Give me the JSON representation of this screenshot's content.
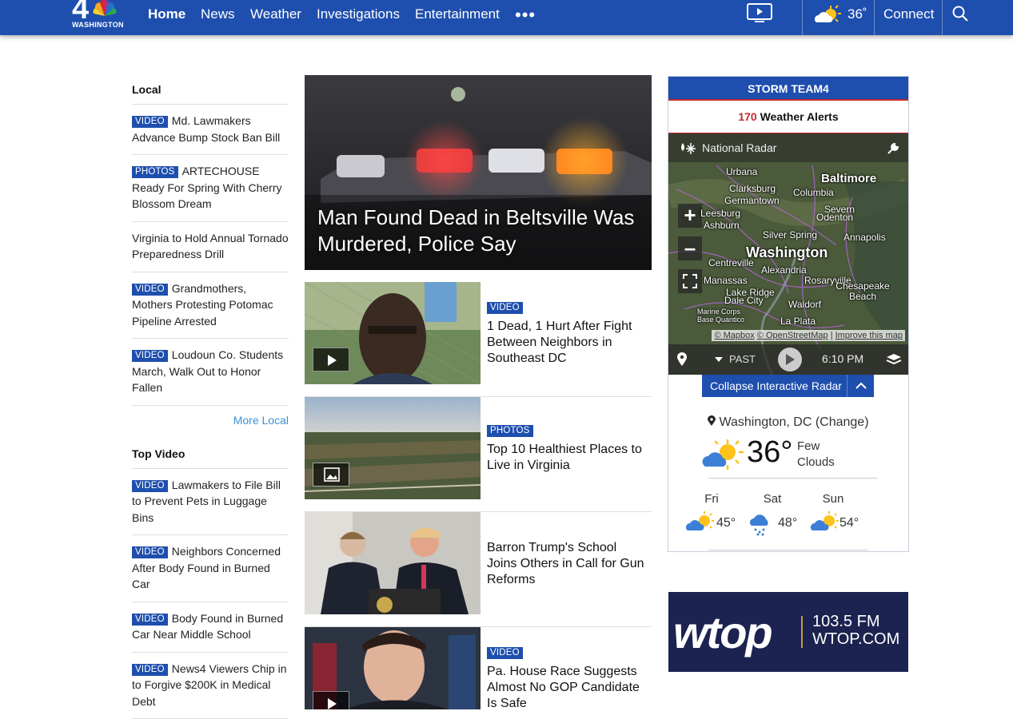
{
  "header": {
    "logo_number": "4",
    "logo_text": "WASHINGTON",
    "nav": [
      "Home",
      "News",
      "Weather",
      "Investigations",
      "Entertainment"
    ],
    "more": "•••",
    "temperature": "36˚",
    "connect": "Connect",
    "bg_color": "#1e4fae"
  },
  "left": {
    "local_title": "Local",
    "local_items": [
      {
        "badge": "VIDEO",
        "text": "Md. Lawmakers Advance Bump Stock Ban Bill"
      },
      {
        "badge": "PHOTOS",
        "text": "ARTECHOUSE Ready For Spring With Cherry Blossom Dream"
      },
      {
        "badge": "",
        "text": "Virginia to Hold Annual Tornado Preparedness Drill"
      },
      {
        "badge": "VIDEO",
        "text": "Grandmothers, Mothers Protesting Potomac Pipeline Arrested"
      },
      {
        "badge": "VIDEO",
        "text": "Loudoun Co. Students March, Walk Out to Honor Fallen"
      }
    ],
    "more_local": "More Local",
    "video_title": "Top Video",
    "video_items": [
      {
        "badge": "VIDEO",
        "text": "Lawmakers to File Bill to Prevent Pets in Luggage Bins"
      },
      {
        "badge": "VIDEO",
        "text": "Neighbors Concerned After Body Found in Burned Car"
      },
      {
        "badge": "VIDEO",
        "text": "Body Found in Burned Car Near Middle School"
      },
      {
        "badge": "VIDEO",
        "text": "News4 Viewers Chip in to Forgive $200K in Medical Debt"
      }
    ]
  },
  "center": {
    "hero_title": "Man Found Dead in Beltsville Was Murdered, Police Say",
    "stories": [
      {
        "badge": "VIDEO",
        "title": "1 Dead, 1 Hurt After Fight Between Neighbors in Southeast DC"
      },
      {
        "badge": "PHOTOS",
        "title": "Top 10 Healthiest Places to Live in Virginia"
      },
      {
        "badge": "",
        "title": "Barron Trump's School Joins Others in Call for Gun Reforms"
      },
      {
        "badge": "VIDEO",
        "title": "Pa. House Race Suggests Almost No GOP Candidate Is Safe"
      }
    ]
  },
  "weather": {
    "brand": "STORM TEAM4",
    "alerts_count": "170",
    "alerts_label": "Weather Alerts",
    "radar_title": "National Radar",
    "map_cities": [
      "Urbana",
      "Clarksburg",
      "Germantown",
      "Baltimore",
      "Columbia",
      "Severn",
      "Odenton",
      "Silver Spring",
      "Annapolis",
      "Washington",
      "Alexandria",
      "Centreville",
      "Manassas",
      "Rosaryville",
      "Lake Ridge",
      "Dale City",
      "Chesapeake Beach",
      "Waldorf",
      "Marine Corps Base Quantico",
      "La Plata",
      "Ashburn",
      "Leesburg"
    ],
    "map_attribution": [
      "© Mapbox",
      "© OpenStreetMap",
      "Improve this map"
    ],
    "past_label": "PAST",
    "time": "6:10 PM",
    "collapse_label": "Collapse Interactive Radar",
    "location": "Washington, DC (Change)",
    "current_temp": "36°",
    "current_desc": "Few Clouds",
    "forecast": [
      {
        "day": "Fri",
        "temp": "45°",
        "icon": "partly-sunny-icon"
      },
      {
        "day": "Sat",
        "temp": "48°",
        "icon": "rain-icon"
      },
      {
        "day": "Sun",
        "temp": "54°",
        "icon": "partly-sunny-icon"
      }
    ]
  },
  "ad": {
    "logo": "wtop",
    "line1": "103.5 FM",
    "line2": "WTOP.COM"
  }
}
